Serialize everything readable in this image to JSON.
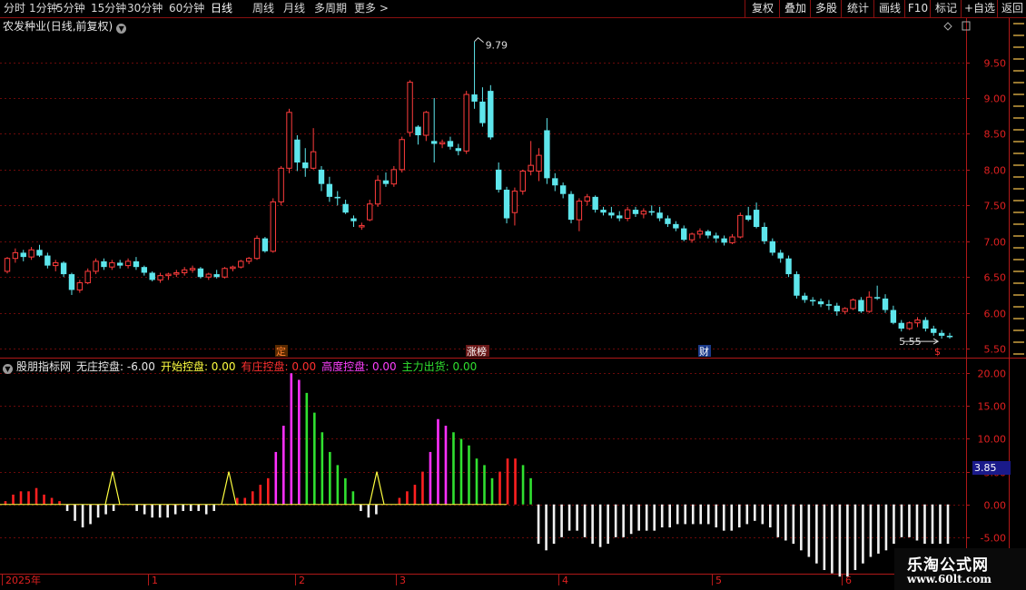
{
  "toolbar": {
    "left": [
      "分时",
      "1分钟",
      "5分钟",
      "15分钟",
      "30分钟",
      "60分钟",
      "日线",
      "周线",
      "月线",
      "多周期",
      "更多 >"
    ],
    "active": "日线",
    "right": [
      "复权",
      "叠加",
      "多股",
      "统计",
      "画线",
      "F10",
      "标记",
      "+自选",
      "返回"
    ]
  },
  "stock": {
    "name": "农发种业",
    "mode": "(日线,前复权)"
  },
  "price_axis": [
    "9.50",
    "9.00",
    "8.50",
    "8.00",
    "7.50",
    "7.00",
    "6.50",
    "6.00",
    "5.50"
  ],
  "annotations": {
    "high": "9.79",
    "low": "5.55"
  },
  "event_tags": [
    {
      "text": "定",
      "color": "#ff8030",
      "bg": "#5a2a00"
    },
    {
      "text": "涨榜",
      "color": "#ffffff",
      "bg": "#6a1818"
    },
    {
      "text": "财",
      "color": "#ffffff",
      "bg": "#1a3a8a"
    },
    {
      "text": "$",
      "color": "#ff3030",
      "bg": "transparent"
    }
  ],
  "indicator": {
    "name": "股朋指标网",
    "items": [
      {
        "label": "无庄控盘:",
        "value": "-6.00",
        "color": "#e8e8e8"
      },
      {
        "label": "开始控盘:",
        "value": "0.00",
        "color": "#ffff40"
      },
      {
        "label": "有庄控盘:",
        "value": "0.00",
        "color": "#ff3030"
      },
      {
        "label": "高度控盘:",
        "value": "0.00",
        "color": "#ff40ff"
      },
      {
        "label": "主力出货:",
        "value": "0.00",
        "color": "#30e030"
      }
    ]
  },
  "indicator_axis": [
    "20.00",
    "15.00",
    "10.00",
    "5.00",
    "0.00",
    "-5.00"
  ],
  "current_value": "3.85",
  "time_axis": [
    "2025年",
    "1",
    "2",
    "3",
    "4",
    "5",
    "6"
  ],
  "watermark": {
    "line1": "乐淘公式网",
    "line2": "www.60lt.com"
  },
  "colors": {
    "up": "#ff3c3c",
    "down": "#5ee6ec",
    "grid": "#6a0a0a",
    "border": "#b01818"
  },
  "chart_data": {
    "type": "candlestick",
    "ylim": [
      5.4,
      9.9
    ],
    "candles": [
      [
        6.58,
        6.78,
        6.55,
        6.76
      ],
      [
        6.76,
        6.9,
        6.7,
        6.84
      ],
      [
        6.84,
        6.88,
        6.72,
        6.78
      ],
      [
        6.78,
        6.92,
        6.74,
        6.88
      ],
      [
        6.88,
        6.95,
        6.78,
        6.8
      ],
      [
        6.8,
        6.84,
        6.62,
        6.66
      ],
      [
        6.66,
        6.74,
        6.58,
        6.7
      ],
      [
        6.7,
        6.72,
        6.5,
        6.54
      ],
      [
        6.54,
        6.56,
        6.25,
        6.32
      ],
      [
        6.32,
        6.46,
        6.28,
        6.42
      ],
      [
        6.42,
        6.62,
        6.4,
        6.58
      ],
      [
        6.58,
        6.76,
        6.54,
        6.72
      ],
      [
        6.72,
        6.76,
        6.6,
        6.64
      ],
      [
        6.64,
        6.74,
        6.6,
        6.7
      ],
      [
        6.7,
        6.74,
        6.62,
        6.66
      ],
      [
        6.66,
        6.76,
        6.62,
        6.72
      ],
      [
        6.72,
        6.78,
        6.6,
        6.64
      ],
      [
        6.64,
        6.66,
        6.52,
        6.56
      ],
      [
        6.56,
        6.58,
        6.44,
        6.46
      ],
      [
        6.46,
        6.56,
        6.42,
        6.52
      ],
      [
        6.52,
        6.56,
        6.46,
        6.54
      ],
      [
        6.54,
        6.6,
        6.5,
        6.56
      ],
      [
        6.56,
        6.64,
        6.52,
        6.6
      ],
      [
        6.6,
        6.66,
        6.56,
        6.62
      ],
      [
        6.62,
        6.64,
        6.48,
        6.5
      ],
      [
        6.5,
        6.56,
        6.46,
        6.54
      ],
      [
        6.54,
        6.6,
        6.48,
        6.5
      ],
      [
        6.5,
        6.64,
        6.48,
        6.62
      ],
      [
        6.62,
        6.66,
        6.58,
        6.64
      ],
      [
        6.64,
        6.74,
        6.62,
        6.72
      ],
      [
        6.72,
        6.78,
        6.68,
        6.76
      ],
      [
        6.76,
        7.08,
        6.74,
        7.04
      ],
      [
        7.04,
        7.06,
        6.84,
        6.86
      ],
      [
        6.86,
        7.6,
        6.84,
        7.55
      ],
      [
        7.55,
        8.05,
        7.5,
        8.02
      ],
      [
        8.02,
        8.85,
        7.95,
        8.8
      ],
      [
        8.42,
        8.48,
        7.98,
        8.1
      ],
      [
        8.1,
        8.3,
        7.9,
        8.02
      ],
      [
        8.02,
        8.58,
        8.0,
        8.25
      ],
      [
        8.0,
        8.05,
        7.7,
        7.8
      ],
      [
        7.8,
        7.9,
        7.55,
        7.62
      ],
      [
        7.62,
        7.7,
        7.5,
        7.6
      ],
      [
        7.52,
        7.58,
        7.38,
        7.4
      ],
      [
        7.32,
        7.36,
        7.2,
        7.28
      ],
      [
        7.2,
        7.26,
        7.16,
        7.22
      ],
      [
        7.3,
        7.58,
        7.28,
        7.52
      ],
      [
        7.52,
        7.92,
        7.48,
        7.85
      ],
      [
        7.85,
        7.96,
        7.76,
        7.8
      ],
      [
        7.8,
        8.05,
        7.76,
        8.0
      ],
      [
        8.0,
        8.46,
        7.96,
        8.42
      ],
      [
        8.52,
        9.25,
        8.46,
        9.22
      ],
      [
        8.6,
        8.62,
        8.35,
        8.48
      ],
      [
        8.48,
        8.82,
        8.4,
        8.8
      ],
      [
        8.4,
        9.0,
        8.1,
        8.36
      ],
      [
        8.36,
        8.42,
        8.3,
        8.38
      ],
      [
        8.4,
        8.46,
        8.28,
        8.32
      ],
      [
        8.3,
        8.36,
        8.2,
        8.26
      ],
      [
        8.26,
        9.1,
        8.22,
        9.05
      ],
      [
        9.05,
        9.79,
        8.85,
        8.95
      ],
      [
        8.95,
        9.15,
        8.6,
        8.65
      ],
      [
        9.1,
        9.18,
        8.42,
        8.45
      ],
      [
        8.0,
        8.1,
        7.68,
        7.72
      ],
      [
        7.72,
        7.76,
        7.25,
        7.32
      ],
      [
        7.4,
        7.75,
        7.22,
        7.7
      ],
      [
        7.7,
        8.0,
        7.65,
        7.98
      ],
      [
        7.98,
        8.4,
        7.92,
        8.06
      ],
      [
        7.98,
        8.3,
        7.84,
        8.2
      ],
      [
        8.55,
        8.72,
        7.8,
        7.88
      ],
      [
        7.88,
        7.95,
        7.7,
        7.78
      ],
      [
        7.78,
        7.82,
        7.6,
        7.66
      ],
      [
        7.66,
        7.7,
        7.25,
        7.3
      ],
      [
        7.3,
        7.6,
        7.14,
        7.56
      ],
      [
        7.56,
        7.66,
        7.5,
        7.62
      ],
      [
        7.62,
        7.64,
        7.4,
        7.44
      ],
      [
        7.44,
        7.48,
        7.36,
        7.4
      ],
      [
        7.4,
        7.48,
        7.32,
        7.36
      ],
      [
        7.36,
        7.42,
        7.28,
        7.32
      ],
      [
        7.32,
        7.48,
        7.28,
        7.44
      ],
      [
        7.44,
        7.48,
        7.34,
        7.38
      ],
      [
        7.38,
        7.46,
        7.32,
        7.42
      ],
      [
        7.42,
        7.5,
        7.36,
        7.4
      ],
      [
        7.4,
        7.48,
        7.28,
        7.32
      ],
      [
        7.32,
        7.36,
        7.2,
        7.24
      ],
      [
        7.24,
        7.28,
        7.14,
        7.18
      ],
      [
        7.18,
        7.22,
        7.0,
        7.02
      ],
      [
        7.02,
        7.12,
        6.98,
        7.1
      ],
      [
        7.1,
        7.18,
        7.04,
        7.14
      ],
      [
        7.14,
        7.16,
        7.04,
        7.08
      ],
      [
        7.08,
        7.12,
        6.98,
        7.04
      ],
      [
        7.04,
        7.08,
        6.94,
        6.98
      ],
      [
        6.98,
        7.1,
        6.96,
        7.06
      ],
      [
        7.06,
        7.4,
        7.04,
        7.36
      ],
      [
        7.36,
        7.48,
        7.28,
        7.3
      ],
      [
        7.44,
        7.54,
        7.18,
        7.2
      ],
      [
        7.2,
        7.26,
        6.96,
        7.0
      ],
      [
        7.0,
        7.04,
        6.8,
        6.84
      ],
      [
        6.84,
        6.88,
        6.7,
        6.76
      ],
      [
        6.76,
        6.8,
        6.5,
        6.54
      ],
      [
        6.54,
        6.58,
        6.2,
        6.24
      ],
      [
        6.24,
        6.28,
        6.14,
        6.18
      ],
      [
        6.18,
        6.22,
        6.1,
        6.16
      ],
      [
        6.16,
        6.2,
        6.08,
        6.12
      ],
      [
        6.12,
        6.18,
        6.04,
        6.1
      ],
      [
        6.1,
        6.14,
        5.96,
        6.02
      ],
      [
        6.02,
        6.08,
        5.98,
        6.06
      ],
      [
        6.06,
        6.2,
        6.04,
        6.18
      ],
      [
        6.18,
        6.22,
        6.0,
        6.02
      ],
      [
        6.02,
        6.3,
        6.0,
        6.22
      ],
      [
        6.22,
        6.38,
        6.18,
        6.2
      ],
      [
        6.2,
        6.26,
        6.0,
        6.04
      ],
      [
        6.04,
        6.1,
        5.84,
        5.86
      ],
      [
        5.86,
        5.9,
        5.74,
        5.78
      ],
      [
        5.78,
        5.88,
        5.76,
        5.86
      ],
      [
        5.86,
        5.94,
        5.8,
        5.9
      ],
      [
        5.9,
        5.94,
        5.74,
        5.78
      ],
      [
        5.78,
        5.82,
        5.68,
        5.72
      ],
      [
        5.72,
        5.76,
        5.64,
        5.68
      ],
      [
        5.68,
        5.72,
        5.64,
        5.66
      ]
    ],
    "indicator_ylim": [
      -10,
      21
    ],
    "indicator_values": [
      0.5,
      1.5,
      2,
      2,
      2.5,
      1.5,
      1,
      0.5,
      -1,
      -2.5,
      -3.5,
      -3,
      -2,
      -1.5,
      -1,
      0,
      0,
      -1,
      -1.5,
      -2,
      -2,
      -2,
      -1.5,
      -1,
      -1,
      -1,
      -1.5,
      -1,
      0,
      0,
      1,
      1,
      2,
      3,
      4,
      8,
      12,
      20,
      19,
      17,
      14,
      11,
      8,
      6,
      4,
      2,
      -1,
      -2,
      -1.5,
      0,
      0,
      1,
      2,
      3,
      5,
      8,
      13,
      12,
      11,
      10,
      9,
      7,
      6,
      4,
      5,
      7,
      7,
      6,
      4,
      -6,
      -7,
      -6,
      -5,
      -4,
      -4,
      -5,
      -6,
      -6.5,
      -6,
      -5,
      -5,
      -4.5,
      -4,
      -4,
      -4,
      -3.5,
      -3.5,
      -3,
      -3,
      -3,
      -3,
      -3,
      -3.5,
      -4,
      -4,
      -3.5,
      -3,
      -2.5,
      -3,
      -3.5,
      -5,
      -5.5,
      -6,
      -7,
      -8,
      -9,
      -10,
      -10.5,
      -11,
      -11,
      -10,
      -9,
      -8,
      -7.5,
      -7,
      -6,
      -5,
      -5,
      -5.5,
      -6,
      -6,
      -6,
      -6
    ],
    "indicator_colors": {
      "neg": "#f2f2f2",
      "red": "#ff2020",
      "magenta": "#ff30ff",
      "green": "#30e030",
      "yellow": "#ffff40"
    }
  }
}
